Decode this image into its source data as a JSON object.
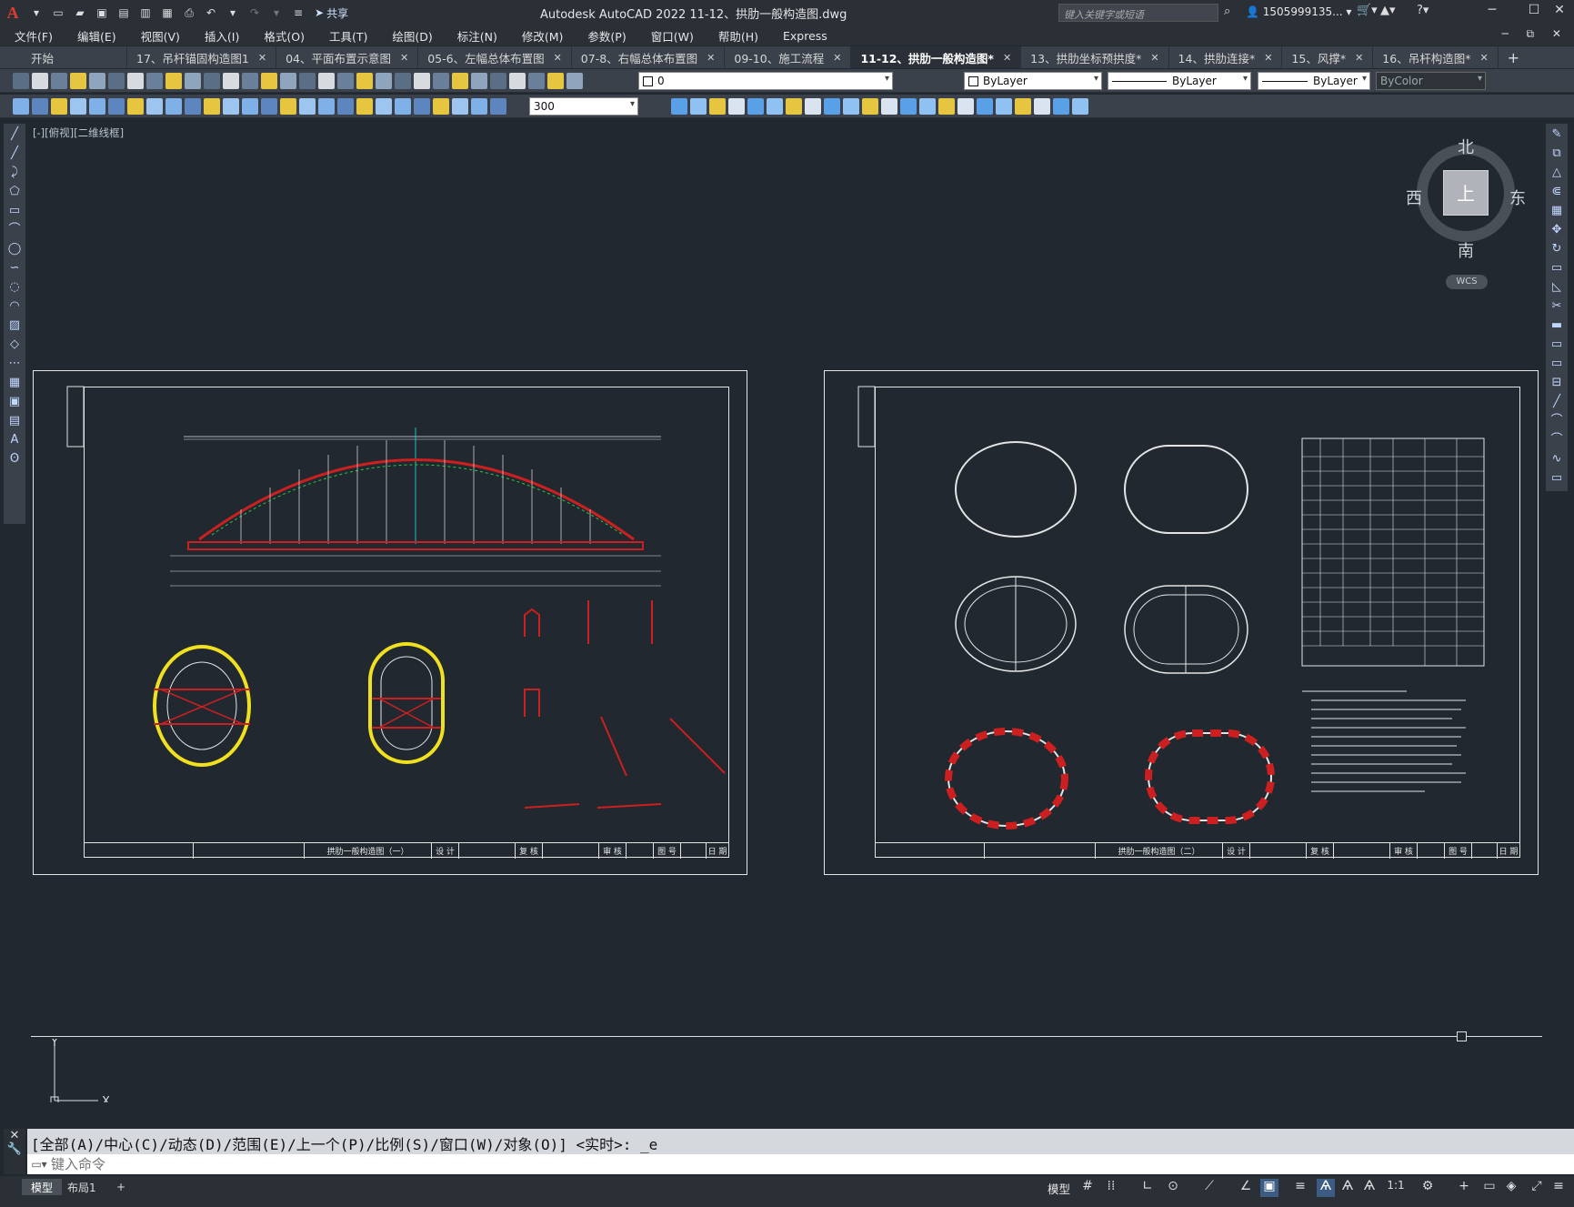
{
  "app": {
    "logo": "A",
    "title": "Autodesk AutoCAD 2022    11-12、拱肋一般构造图.dwg",
    "share": "共享",
    "search_placeholder": "键入关键字或短语",
    "user": "1505999135...",
    "menus": [
      "文件(F)",
      "编辑(E)",
      "视图(V)",
      "插入(I)",
      "格式(O)",
      "工具(T)",
      "绘图(D)",
      "标注(N)",
      "修改(M)",
      "参数(P)",
      "窗口(W)",
      "帮助(H)",
      "Express"
    ]
  },
  "tabs": [
    {
      "label": "开始",
      "active": false,
      "closable": false
    },
    {
      "label": "17、吊杆锚固构造图1",
      "active": false,
      "closable": true
    },
    {
      "label": "04、平面布置示意图",
      "active": false,
      "closable": true
    },
    {
      "label": "05-6、左幅总体布置图",
      "active": false,
      "closable": true
    },
    {
      "label": "07-8、右幅总体布置图",
      "active": false,
      "closable": true
    },
    {
      "label": "09-10、施工流程",
      "active": false,
      "closable": true
    },
    {
      "label": "11-12、拱肋一般构造图*",
      "active": true,
      "closable": true
    },
    {
      "label": "13、拱肋坐标预拱度*",
      "active": false,
      "closable": true
    },
    {
      "label": "14、拱肋连接*",
      "active": false,
      "closable": true
    },
    {
      "label": "15、风撑*",
      "active": false,
      "closable": true
    },
    {
      "label": "16、吊杆构造图*",
      "active": false,
      "closable": true
    }
  ],
  "toolbar": {
    "layer_value": "0",
    "color_value": "ByLayer",
    "linetype_value": "ByLayer",
    "lineweight_value": "ByLayer",
    "plotstyle_value": "ByColor",
    "scale_value": "300"
  },
  "viewport": {
    "label": "[-][俯视][二维线框]",
    "viewcube": {
      "north": "北",
      "south": "南",
      "east": "东",
      "west": "西",
      "face": "上"
    },
    "wcs": "WCS"
  },
  "sheets": {
    "left_title": "拱肋一般构造图（一）",
    "right_title": "拱肋一般构造图（二）",
    "block_labels": [
      "设 计",
      "复 核",
      "审 核",
      "图 号",
      "日 期"
    ]
  },
  "command": {
    "history": "[全部(A)/中心(C)/动态(D)/范围(E)/上一个(P)/比例(S)/窗口(W)/对象(O)] <实时>: _e",
    "placeholder": "键入命令"
  },
  "status": {
    "layout_tabs": [
      "模型",
      "布局1"
    ],
    "model_label": "模型",
    "scale": "1:1"
  }
}
